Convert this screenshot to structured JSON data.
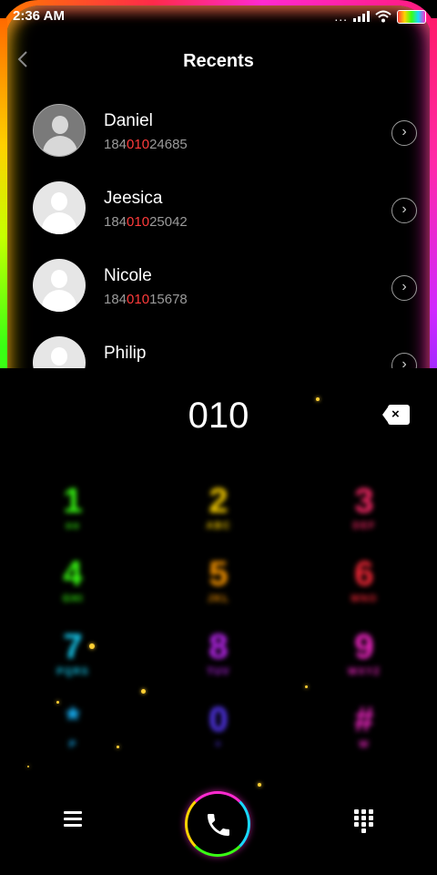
{
  "status": {
    "time": "2:36 AM",
    "dots": "...",
    "signal-label": "signal",
    "wifi-label": "wifi"
  },
  "header": {
    "title": "Recents",
    "back_icon": "chevron-left-icon"
  },
  "contacts": [
    {
      "name": "Daniel",
      "num_pre": "184",
      "num_hl": "010",
      "num_post": "24685",
      "avatar": "dark"
    },
    {
      "name": "Jeesica",
      "num_pre": "184",
      "num_hl": "010",
      "num_post": "25042",
      "avatar": "light"
    },
    {
      "name": "Nicole",
      "num_pre": "184",
      "num_hl": "010",
      "num_post": "15678",
      "avatar": "light"
    },
    {
      "name": "Philip",
      "num_pre": "",
      "num_hl": "",
      "num_post": "",
      "avatar": "light"
    }
  ],
  "dialer": {
    "entry": "010",
    "keys": [
      {
        "digit": "1",
        "letters": "oo",
        "color": "#39ff14"
      },
      {
        "digit": "2",
        "letters": "ABC",
        "color": "#ffd400"
      },
      {
        "digit": "3",
        "letters": "DEF",
        "color": "#ff2a6a"
      },
      {
        "digit": "4",
        "letters": "GHI",
        "color": "#39ff14"
      },
      {
        "digit": "5",
        "letters": "JKL",
        "color": "#ff9a00"
      },
      {
        "digit": "6",
        "letters": "MNO",
        "color": "#ff2a3a"
      },
      {
        "digit": "7",
        "letters": "PQRS",
        "color": "#18d8ff"
      },
      {
        "digit": "8",
        "letters": "TUV",
        "color": "#c72aff"
      },
      {
        "digit": "9",
        "letters": "WXYZ",
        "color": "#ff2ad0"
      },
      {
        "digit": "*",
        "letters": "P",
        "color": "#18b8ff"
      },
      {
        "digit": "0",
        "letters": "+",
        "color": "#5a3aff"
      },
      {
        "digit": "#",
        "letters": "W",
        "color": "#ff2ad0"
      }
    ]
  },
  "nav": {
    "menu_icon": "menu-icon",
    "call_icon": "phone-icon",
    "keypad_icon": "keypad-icon"
  }
}
